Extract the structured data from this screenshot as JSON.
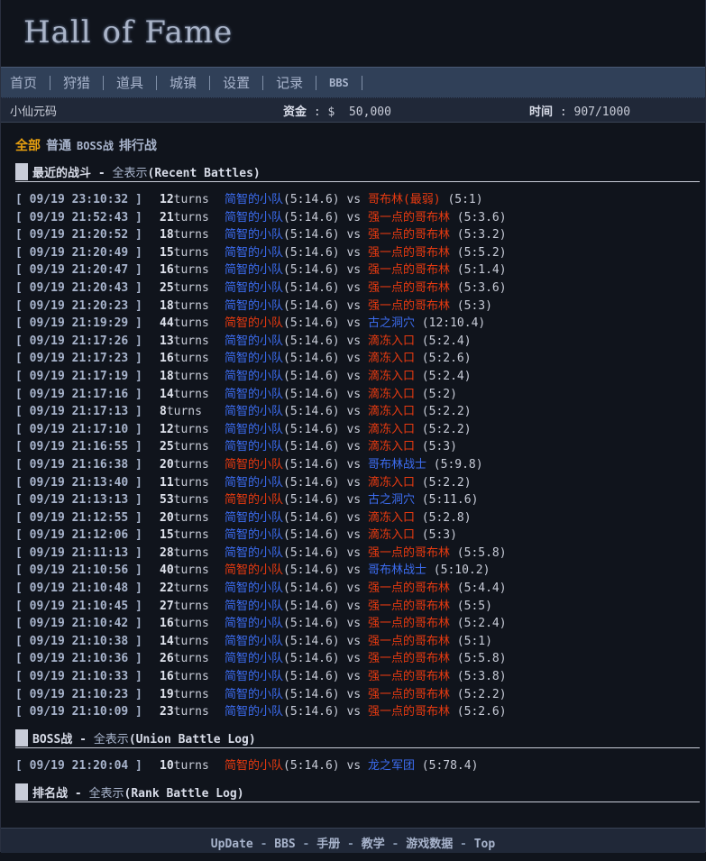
{
  "logo": "Hall of Fame",
  "nav": [
    "首页",
    "狩猎",
    "道具",
    "城镇",
    "设置",
    "记录",
    "BBS"
  ],
  "info": {
    "player": "小仙元码",
    "money_label": "资金",
    "money": "$  50,000",
    "time_label": "时间",
    "time": "907/1000"
  },
  "filters": [
    "全部",
    "普通",
    "BOSS战",
    "排行战"
  ],
  "sections": {
    "recent": {
      "title": "最近的战斗",
      "link": "全表示",
      "suffix": "(Recent Battles)"
    },
    "boss": {
      "title": "BOSS战",
      "link": "全表示",
      "suffix": "(Union Battle Log)"
    },
    "rank": {
      "title": "排名战",
      "link": "全表示",
      "suffix": "(Rank Battle Log)"
    }
  },
  "colors": {
    "blue": "#3c6cf0",
    "red": "#e83a10",
    "active_filter": "#e8a010"
  },
  "team": {
    "name": "简智的小队",
    "stat": "(5:14.6)"
  },
  "recent_battles": [
    [
      "09/19 23:10:32",
      12,
      "blue",
      "哥布林(最弱)",
      "red",
      "(5:1)"
    ],
    [
      "09/19 21:52:43",
      21,
      "blue",
      "强一点的哥布林",
      "red",
      "(5:3.6)"
    ],
    [
      "09/19 21:20:52",
      18,
      "blue",
      "强一点的哥布林",
      "red",
      "(5:3.2)"
    ],
    [
      "09/19 21:20:49",
      15,
      "blue",
      "强一点的哥布林",
      "red",
      "(5:5.2)"
    ],
    [
      "09/19 21:20:47",
      16,
      "blue",
      "强一点的哥布林",
      "red",
      "(5:1.4)"
    ],
    [
      "09/19 21:20:43",
      25,
      "blue",
      "强一点的哥布林",
      "red",
      "(5:3.6)"
    ],
    [
      "09/19 21:20:23",
      18,
      "blue",
      "强一点的哥布林",
      "red",
      "(5:3)"
    ],
    [
      "09/19 21:19:29",
      44,
      "red",
      "古之洞穴",
      "blue",
      "(12:10.4)"
    ],
    [
      "09/19 21:17:26",
      13,
      "blue",
      "滴冻入口",
      "red",
      "(5:2.4)"
    ],
    [
      "09/19 21:17:23",
      16,
      "blue",
      "滴冻入口",
      "red",
      "(5:2.6)"
    ],
    [
      "09/19 21:17:19",
      18,
      "blue",
      "滴冻入口",
      "red",
      "(5:2.4)"
    ],
    [
      "09/19 21:17:16",
      14,
      "blue",
      "滴冻入口",
      "red",
      "(5:2)"
    ],
    [
      "09/19 21:17:13",
      8,
      "blue",
      "滴冻入口",
      "red",
      "(5:2.2)"
    ],
    [
      "09/19 21:17:10",
      12,
      "blue",
      "滴冻入口",
      "red",
      "(5:2.2)"
    ],
    [
      "09/19 21:16:55",
      25,
      "blue",
      "滴冻入口",
      "red",
      "(5:3)"
    ],
    [
      "09/19 21:16:38",
      20,
      "red",
      "哥布林战士",
      "blue",
      "(5:9.8)"
    ],
    [
      "09/19 21:13:40",
      11,
      "blue",
      "滴冻入口",
      "red",
      "(5:2.2)"
    ],
    [
      "09/19 21:13:13",
      53,
      "red",
      "古之洞穴",
      "blue",
      "(5:11.6)"
    ],
    [
      "09/19 21:12:55",
      20,
      "blue",
      "滴冻入口",
      "red",
      "(5:2.8)"
    ],
    [
      "09/19 21:12:06",
      15,
      "blue",
      "滴冻入口",
      "red",
      "(5:3)"
    ],
    [
      "09/19 21:11:13",
      28,
      "blue",
      "强一点的哥布林",
      "red",
      "(5:5.8)"
    ],
    [
      "09/19 21:10:56",
      40,
      "red",
      "哥布林战士",
      "blue",
      "(5:10.2)"
    ],
    [
      "09/19 21:10:48",
      22,
      "blue",
      "强一点的哥布林",
      "red",
      "(5:4.4)"
    ],
    [
      "09/19 21:10:45",
      27,
      "blue",
      "强一点的哥布林",
      "red",
      "(5:5)"
    ],
    [
      "09/19 21:10:42",
      16,
      "blue",
      "强一点的哥布林",
      "red",
      "(5:2.4)"
    ],
    [
      "09/19 21:10:38",
      14,
      "blue",
      "强一点的哥布林",
      "red",
      "(5:1)"
    ],
    [
      "09/19 21:10:36",
      26,
      "blue",
      "强一点的哥布林",
      "red",
      "(5:5.8)"
    ],
    [
      "09/19 21:10:33",
      16,
      "blue",
      "强一点的哥布林",
      "red",
      "(5:3.8)"
    ],
    [
      "09/19 21:10:23",
      19,
      "blue",
      "强一点的哥布林",
      "red",
      "(5:2.2)"
    ],
    [
      "09/19 21:10:09",
      23,
      "blue",
      "强一点的哥布林",
      "red",
      "(5:2.6)"
    ]
  ],
  "boss_battles": [
    [
      "09/19 21:20:04",
      10,
      "red",
      "龙之军团",
      "blue",
      "(5:78.4)"
    ]
  ],
  "turns_label": "turns",
  "vs": "vs",
  "footer": [
    "UpDate",
    "BBS",
    "手册",
    "教学",
    "游戏数据",
    "Top"
  ]
}
